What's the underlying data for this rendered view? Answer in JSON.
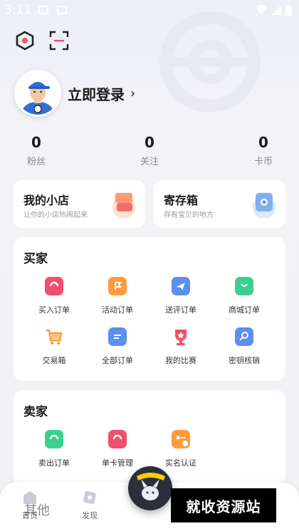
{
  "status": {
    "time": "3:11"
  },
  "profile": {
    "login_label": "立即登录",
    "arrow": "›"
  },
  "stats": [
    {
      "value": "0",
      "label": "粉丝"
    },
    {
      "value": "0",
      "label": "关注"
    },
    {
      "value": "0",
      "label": "卡币"
    }
  ],
  "shop": {
    "title": "我的小店",
    "subtitle": "让你的小店热闹起来"
  },
  "storage": {
    "title": "寄存箱",
    "subtitle": "存有宝贝的地方"
  },
  "buyer": {
    "title": "买家",
    "items": [
      {
        "label": "买入订单",
        "icon": "buy-order-icon",
        "color": "#f0506e"
      },
      {
        "label": "活动订单",
        "icon": "activity-order-icon",
        "color": "#ff9a3c"
      },
      {
        "label": "送评订单",
        "icon": "grading-order-icon",
        "color": "#5b8ff0"
      },
      {
        "label": "商城订单",
        "icon": "mall-order-icon",
        "color": "#3ccf8e"
      },
      {
        "label": "交易箱",
        "icon": "trade-cart-icon",
        "color": "#ff9a3c"
      },
      {
        "label": "全部订单",
        "icon": "all-orders-icon",
        "color": "#5b8ff0"
      },
      {
        "label": "我的比赛",
        "icon": "trophy-icon",
        "color": "#f0506e"
      },
      {
        "label": "密钥核销",
        "icon": "key-verify-icon",
        "color": "#5b8ff0"
      }
    ]
  },
  "seller": {
    "title": "卖家",
    "items": [
      {
        "label": "卖出订单",
        "icon": "sell-order-icon",
        "color": "#3ccf8e"
      },
      {
        "label": "单卡管理",
        "icon": "card-manage-icon",
        "color": "#f0506e"
      },
      {
        "label": "实名认证",
        "icon": "id-verify-icon",
        "color": "#ff9a3c"
      }
    ]
  },
  "ghost_text": "其他",
  "nav": [
    {
      "label": "首页",
      "icon": "home-icon"
    },
    {
      "label": "发现",
      "icon": "discover-icon"
    }
  ],
  "watermark": "就收资源站"
}
